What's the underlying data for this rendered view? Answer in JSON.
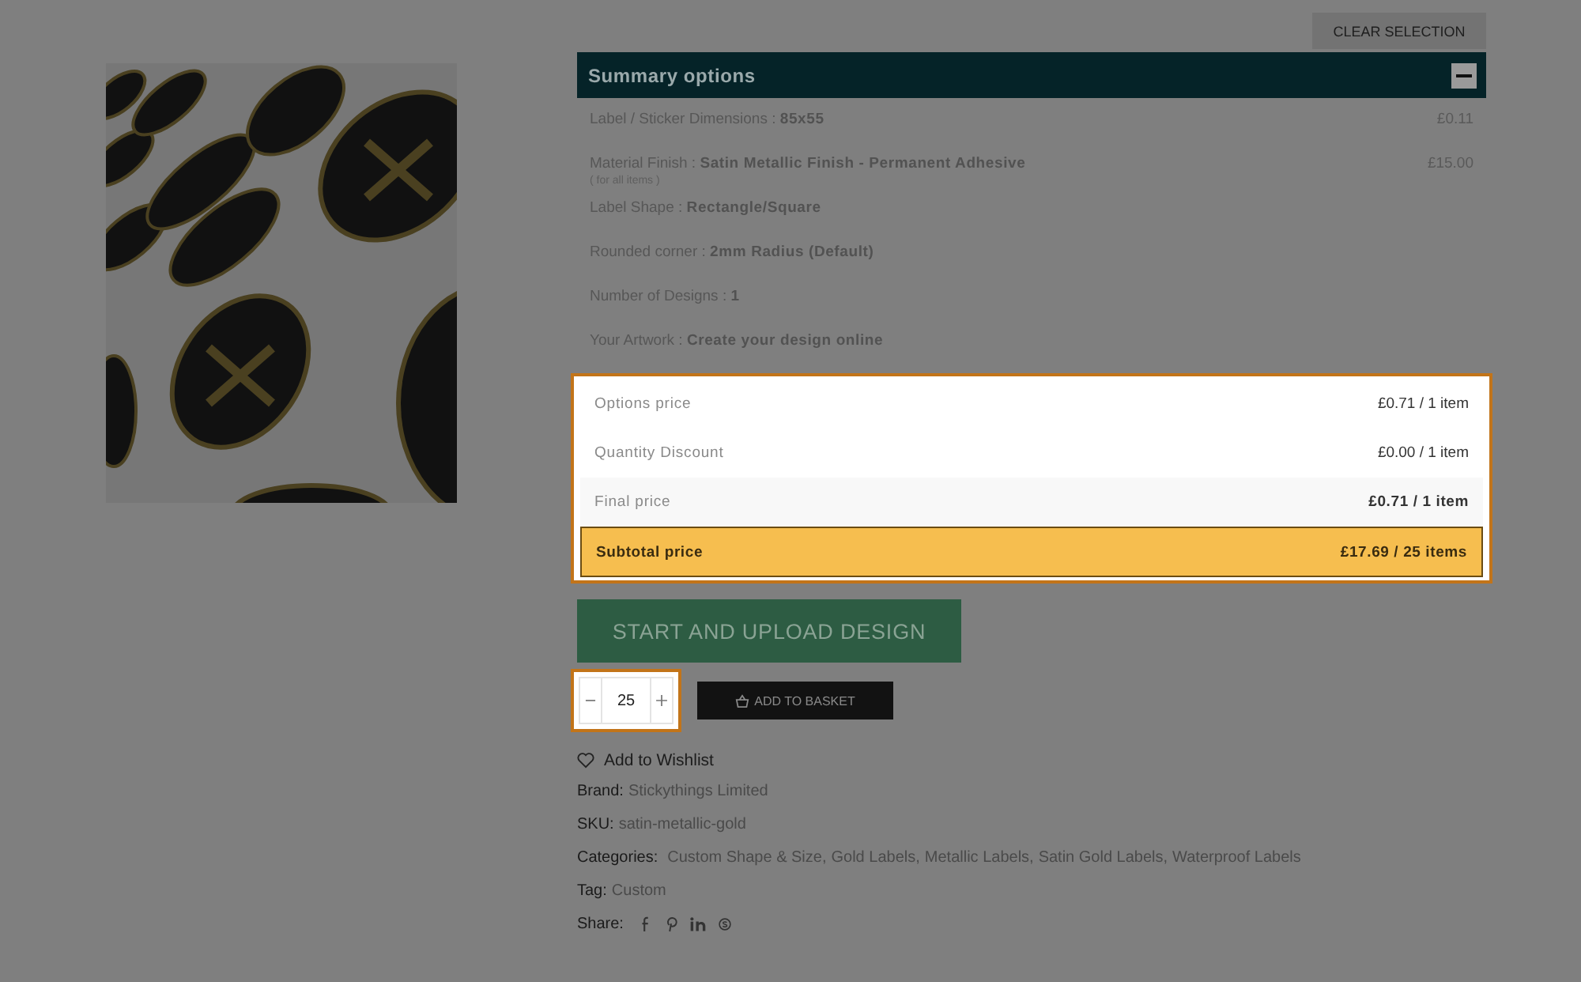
{
  "clear_button": {
    "label": "CLEAR SELECTION"
  },
  "summary": {
    "title": "Summary options",
    "expanded": true,
    "options": [
      {
        "label": "Label / Sticker Dimensions :",
        "value": "85x55",
        "price": "£0.11"
      },
      {
        "label": "Material Finish :",
        "value": "Satin Metallic Finish - Permanent Adhesive",
        "note": "( for all items )",
        "price": "£15.00"
      },
      {
        "label": "Label Shape :",
        "value": "Rectangle/Square"
      },
      {
        "label": "Rounded corner :",
        "value": "2mm Radius (Default)"
      },
      {
        "label": "Number of Designs :",
        "value": "1"
      },
      {
        "label": "Your Artwork :",
        "value": "Create your design online"
      }
    ]
  },
  "price_box": {
    "highlighted": true,
    "rows": [
      {
        "kind": "plain",
        "label": "Options price",
        "value": "£0.71 / 1 item"
      },
      {
        "kind": "plain",
        "label": "Quantity Discount",
        "value": "£0.00 / 1 item"
      },
      {
        "kind": "final",
        "label": "Final price",
        "value": "£0.71 / 1 item"
      },
      {
        "kind": "subtotal",
        "label": "Subtotal price",
        "value": "£17.69 / 25 items"
      }
    ]
  },
  "upload_button": {
    "label": "START AND UPLOAD DESIGN"
  },
  "quantity": {
    "value": "25",
    "highlighted": true
  },
  "basket_button": {
    "label": "ADD TO BASKET"
  },
  "wishlist": {
    "label": "Add to Wishlist"
  },
  "meta": {
    "brand": {
      "label": "Brand:",
      "value": "Stickythings Limited"
    },
    "sku": {
      "label": "SKU:",
      "value": "satin-metallic-gold"
    },
    "categories": {
      "label": "Categories:",
      "items": [
        "Custom Shape & Size,",
        "Gold Labels,",
        "Metallic Labels,",
        "Satin Gold Labels,",
        "Waterproof Labels"
      ]
    },
    "tag": {
      "label": "Tag:",
      "value": "Custom"
    },
    "share": {
      "label": "Share:"
    }
  }
}
